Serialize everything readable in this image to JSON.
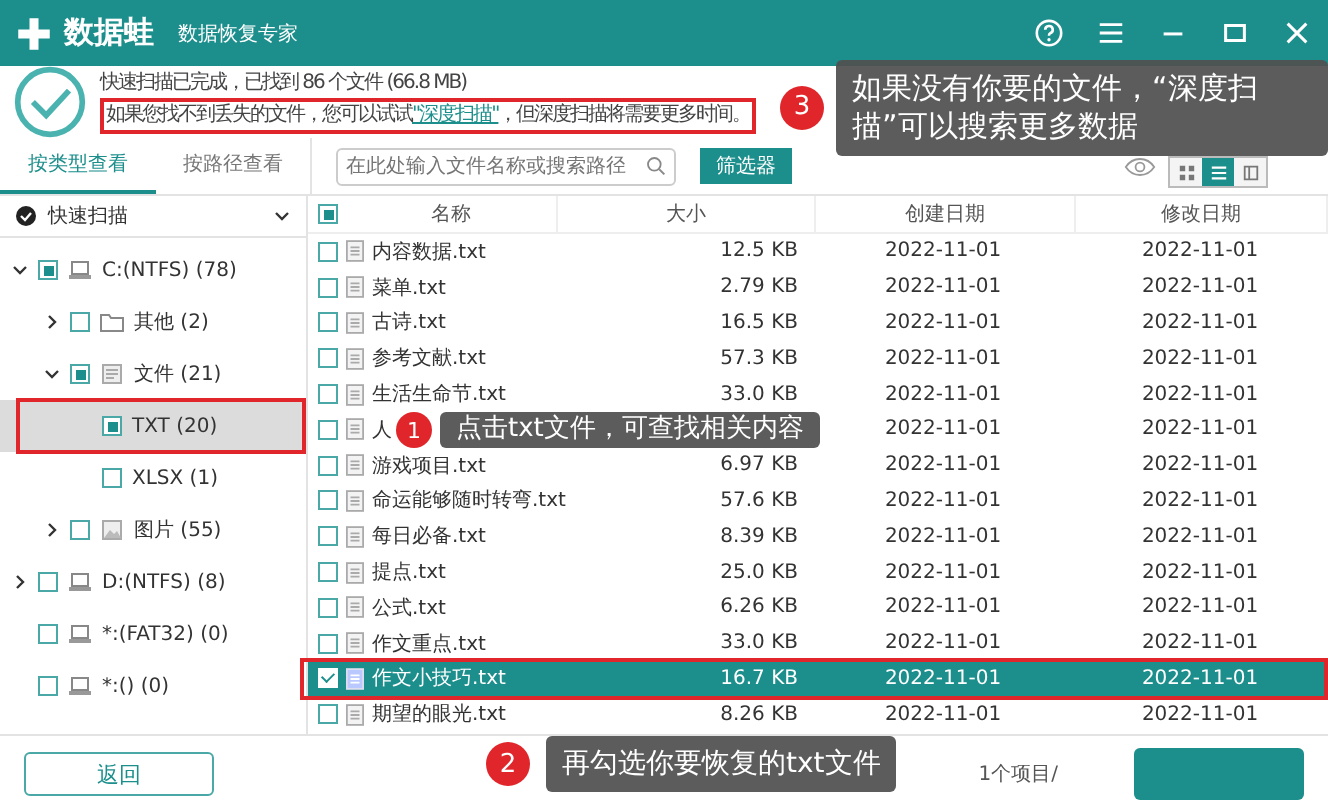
{
  "title_bar": {
    "logo": "数据蛙",
    "subtitle": "数据恢复专家"
  },
  "scan_summary": {
    "status": "快速扫描已完成，已找到 86 个文件 (66.8 MB)",
    "hint_before": "如果您找不到丢失的文件，您可以试试",
    "hint_link": "\"深度扫描\"",
    "hint_after": "，但深度扫描将需要更多时间。"
  },
  "view_tabs": [
    {
      "label": "按类型查看",
      "selected": true
    },
    {
      "label": "按路径查看",
      "selected": false
    }
  ],
  "search": {
    "placeholder": "在此处输入文件名称或搜索路径"
  },
  "filter_button": "筛选器",
  "view_modes": [
    {
      "selected": false
    },
    {
      "selected": true
    },
    {
      "selected": false
    }
  ],
  "scan_dropdown": "快速扫描",
  "tree": [
    {
      "label": "C:(NTFS) (78)",
      "kind": "drive",
      "expanded": true,
      "checked": true,
      "selected": false,
      "children": [
        {
          "label": "其他 (2)",
          "kind": "folder",
          "expanded": false,
          "checked": false,
          "selected": false
        },
        {
          "label": "文件 (21)",
          "kind": "document",
          "expanded": true,
          "checked": true,
          "selected": false,
          "children": [
            {
              "label": "TXT (20)",
              "checked": true,
              "selected": true
            },
            {
              "label": "XLSX (1)",
              "checked": false,
              "selected": false
            }
          ]
        },
        {
          "label": "图片 (55)",
          "kind": "image",
          "expanded": false,
          "checked": false,
          "selected": false
        }
      ]
    },
    {
      "label": "D:(NTFS) (8)",
      "kind": "drive",
      "expanded": false,
      "checked": false,
      "selected": false
    },
    {
      "label": "*:(FAT32) (0)",
      "kind": "drive",
      "checked": false,
      "selected": false
    },
    {
      "label": "*:() (0)",
      "kind": "drive",
      "checked": false,
      "selected": false
    }
  ],
  "table": {
    "columns": [
      "名称",
      "大小",
      "创建日期",
      "修改日期"
    ],
    "header_checked": true,
    "rows": [
      {
        "name": "内容数据.txt",
        "size": "12.5 KB",
        "created": "2022-11-01",
        "modified": "2022-11-01",
        "selected": false
      },
      {
        "name": "菜单.txt",
        "size": "2.79 KB",
        "created": "2022-11-01",
        "modified": "2022-11-01",
        "selected": false
      },
      {
        "name": "古诗.txt",
        "size": "16.5 KB",
        "created": "2022-11-01",
        "modified": "2022-11-01",
        "selected": false
      },
      {
        "name": "参考文献.txt",
        "size": "57.3 KB",
        "created": "2022-11-01",
        "modified": "2022-11-01",
        "selected": false
      },
      {
        "name": "生活生命节.txt",
        "size": "33.0 KB",
        "created": "2022-11-01",
        "modified": "2022-11-01",
        "selected": false
      },
      {
        "name": "人",
        "created": "2022-11-01",
        "modified": "2022-11-01",
        "selected": false
      },
      {
        "name": "游戏项目.txt",
        "size": "6.97 KB",
        "created": "2022-11-01",
        "modified": "2022-11-01",
        "selected": false
      },
      {
        "name": "命运能够随时转弯.txt",
        "size": "57.6 KB",
        "created": "2022-11-01",
        "modified": "2022-11-01",
        "selected": false
      },
      {
        "name": "每日必备.txt",
        "size": "8.39 KB",
        "created": "2022-11-01",
        "modified": "2022-11-01",
        "selected": false
      },
      {
        "name": "提点.txt",
        "size": "25.0 KB",
        "created": "2022-11-01",
        "modified": "2022-11-01",
        "selected": false
      },
      {
        "name": "公式.txt",
        "size": "6.26 KB",
        "created": "2022-11-01",
        "modified": "2022-11-01",
        "selected": false
      },
      {
        "name": "作文重点.txt",
        "size": "33.0 KB",
        "created": "2022-11-01",
        "modified": "2022-11-01",
        "selected": false
      },
      {
        "name": "作文小技巧.txt",
        "size": "16.7 KB",
        "created": "2022-11-01",
        "modified": "2022-11-01",
        "selected": true
      },
      {
        "name": "期望的眼光.txt",
        "size": "8.26 KB",
        "created": "2022-11-01",
        "modified": "2022-11-01",
        "selected": false
      }
    ]
  },
  "back_button": "返回",
  "selection_count": "1个项目/",
  "callouts": [
    {
      "number": "1",
      "text": "点击txt文件，可查找相关内容"
    },
    {
      "number": "2",
      "text": "再勾选你要恢复的txt文件"
    },
    {
      "number": "3",
      "text": "如果没有你要的文件，“深度扫描”可以搜索更多数据"
    }
  ]
}
